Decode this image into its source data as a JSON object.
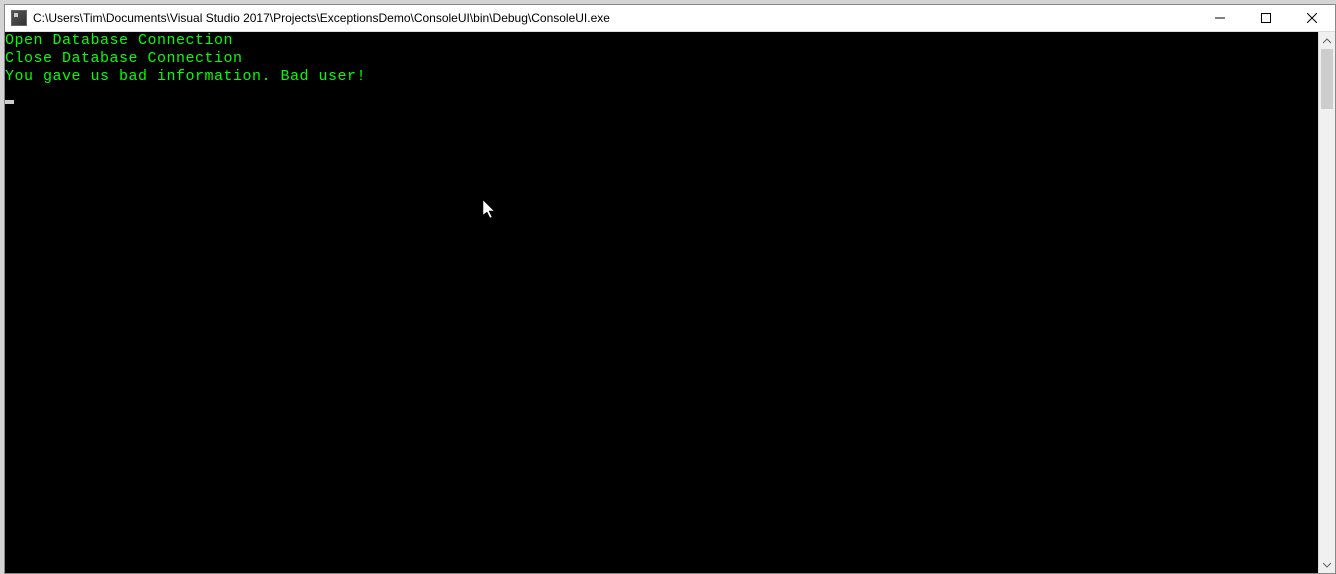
{
  "window": {
    "title": "C:\\Users\\Tim\\Documents\\Visual Studio 2017\\Projects\\ExceptionsDemo\\ConsoleUI\\bin\\Debug\\ConsoleUI.exe"
  },
  "console": {
    "lines": [
      "Open Database Connection",
      "Close Database Connection",
      "You gave us bad information. Bad user!"
    ],
    "text_color": "#00ff00",
    "background_color": "#000000"
  }
}
